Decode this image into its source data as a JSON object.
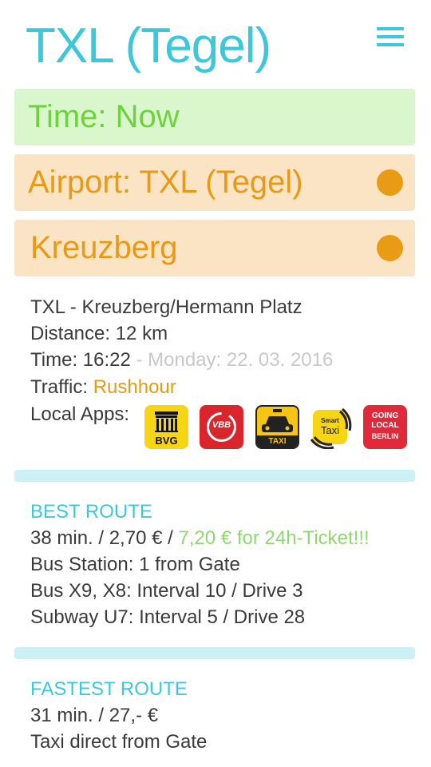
{
  "header": {
    "title": "TXL (Tegel)",
    "menu_icon": "hamburger-menu-icon"
  },
  "selectors": {
    "time": "Time: Now",
    "airport": "Airport: TXL (Tegel)",
    "destination": "Kreuzberg"
  },
  "trip": {
    "route": "TXL - Kreuzberg/Hermann Platz",
    "distance": "Distance: 12 km",
    "time_label": "Time: 16:22",
    "time_date": " - Monday: 22. 03. 2016",
    "traffic_label": "Traffic: ",
    "traffic_value": "Rushhour",
    "apps_label": "Local Apps:"
  },
  "apps": {
    "bvg": "BVG",
    "vbb": "VBB",
    "taxi": "TAXI",
    "smart_top": "Smart",
    "smart_bottom": "Taxi",
    "going_1": "GOING",
    "going_2": "LOCAL",
    "going_3": "BERLIN"
  },
  "best_route": {
    "heading": "BEST ROUTE",
    "price": "38 min. / 2,70 € / ",
    "ticket": "7,20 € for 24h-Ticket!!!",
    "station": "Bus Station: 1 from Gate",
    "bus": "Bus X9, X8: Interval 10 /  Drive 3",
    "subway": "Subway U7: Interval 5 / Drive 28"
  },
  "fastest_route": {
    "heading": "FASTEST ROUTE",
    "price": "31 min. / 27,- €",
    "desc": "Taxi direct from Gate"
  },
  "colors": {
    "accent": "#3cc8d8",
    "green": "#6ed13e",
    "orange": "#e89a16",
    "time_bg": "#d9f6cd",
    "place_bg": "#fae4c4",
    "divider": "#ccf0f5"
  }
}
